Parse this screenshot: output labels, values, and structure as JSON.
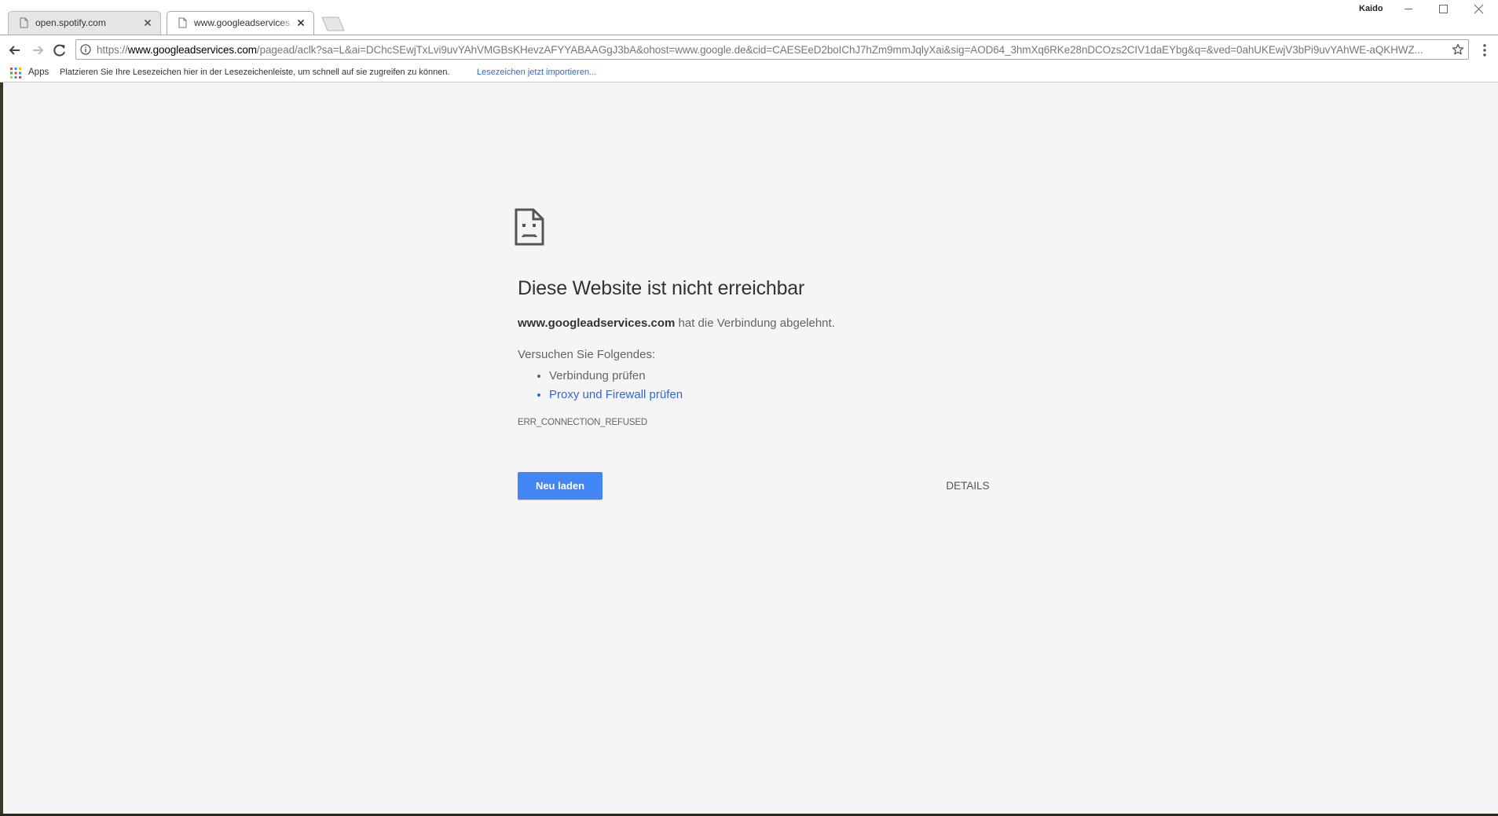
{
  "window": {
    "profile_name": "Kaido"
  },
  "tabs": [
    {
      "title": "open.spotify.com",
      "active": false
    },
    {
      "title": "www.googleadservices.com",
      "active": true
    }
  ],
  "toolbar": {
    "url_scheme": "https://",
    "url_host": "www.googleadservices.com",
    "url_rest": "/pagead/aclk?sa=L&ai=DChcSEwjTxLvi9uvYAhVMGBsKHevzAFYYABAAGgJ3bA&ohost=www.google.de&cid=CAESEeD2boIChJ7hZm9mmJqlyXai&sig=AOD64_3hmXq6RKe28nDCOzs2CIV1daEYbg&q=&ved=0ahUKEwjV3bPi9uvYAhWE-aQKHWZ..."
  },
  "bookmarks": {
    "apps_label": "Apps",
    "hint": "Platzieren Sie Ihre Lesezeichen hier in der Lesezeichenleiste, um schnell auf sie zugreifen zu können.",
    "import_link": "Lesezeichen jetzt importieren..."
  },
  "error_page": {
    "heading": "Diese Website ist nicht erreichbar",
    "host": "www.googleadservices.com",
    "summary_rest": " hat die Verbindung abgelehnt.",
    "suggestions_heading": "Versuchen Sie Folgendes:",
    "suggestions": [
      "Verbindung prüfen",
      "Proxy und Firewall prüfen"
    ],
    "error_code": "ERR_CONNECTION_REFUSED",
    "reload_label": "Neu laden",
    "details_label": "DETAILS",
    "button_color": "#4285f4",
    "link_color": "#3367d6"
  }
}
